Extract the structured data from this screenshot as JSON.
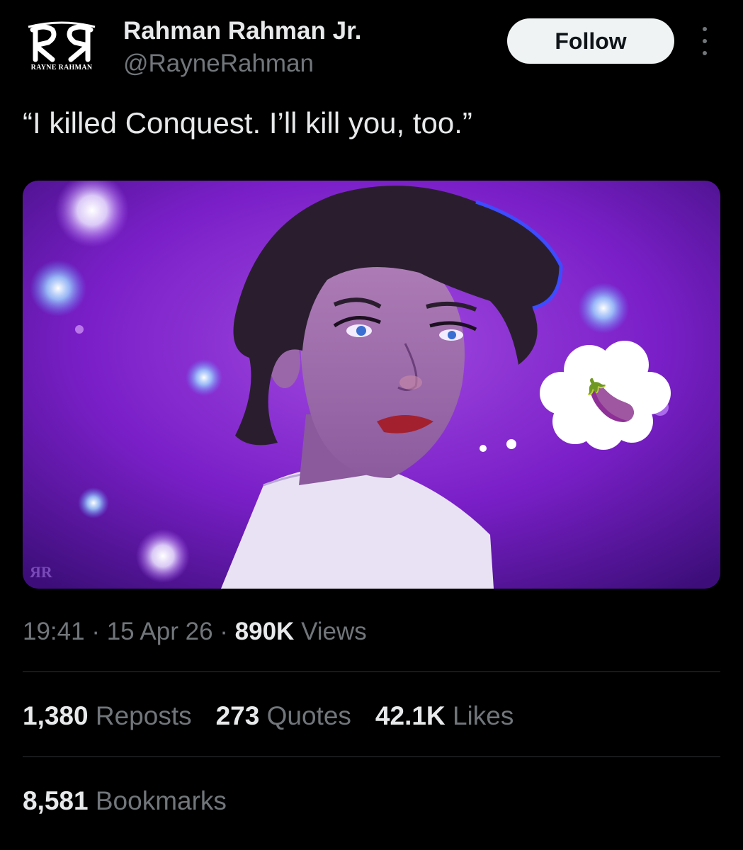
{
  "author": {
    "avatar_text": "RAYNE RAHMAN",
    "display_name": "Rahman Rahman Jr.",
    "handle": "@RayneRahman"
  },
  "actions": {
    "follow_label": "Follow",
    "more_icon": "more-vertical-icon"
  },
  "tweet": {
    "text": "“I killed Conquest. I’ll kill you, too.”",
    "media": {
      "thought_emoji": "🍆"
    }
  },
  "meta": {
    "time": "19:41",
    "separator": " · ",
    "date": "15 Apr 26",
    "views_count": "890K",
    "views_label": "Views"
  },
  "stats": [
    {
      "count": "1,380",
      "label": "Reposts"
    },
    {
      "count": "273",
      "label": "Quotes"
    },
    {
      "count": "42.1K",
      "label": "Likes"
    }
  ],
  "bookmarks": {
    "count": "8,581",
    "label": "Bookmarks"
  },
  "colors": {
    "background": "#000000",
    "text": "#e7e9ea",
    "muted": "#71767b",
    "divider": "#2f3336",
    "follow_bg": "#eff3f4"
  }
}
